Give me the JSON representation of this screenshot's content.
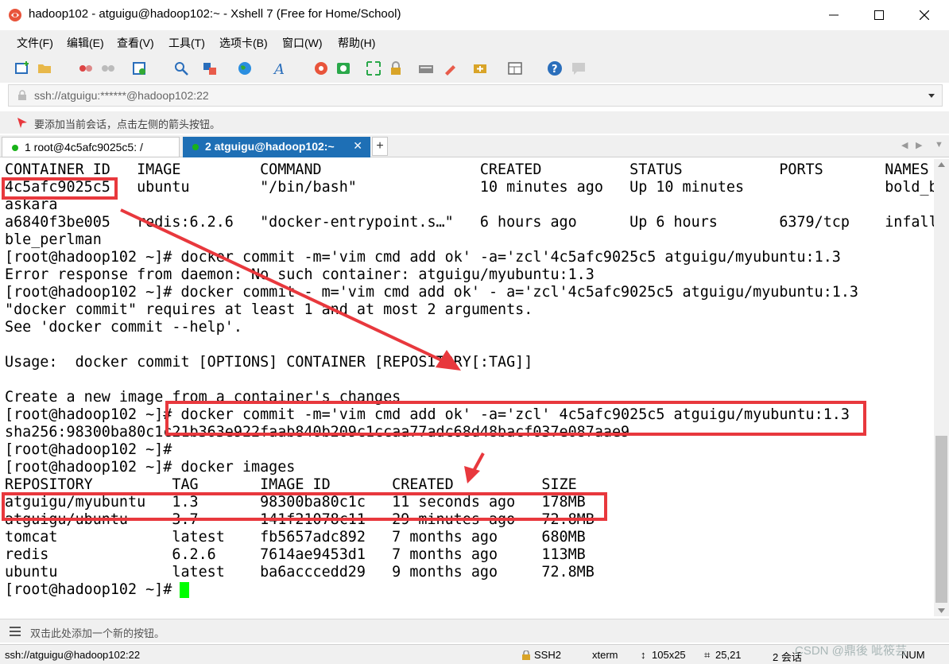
{
  "window": {
    "title": "hadoop102 - atguigu@hadoop102:~ - Xshell 7 (Free for Home/School)"
  },
  "menu": [
    "文件(F)",
    "编辑(E)",
    "查看(V)",
    "工具(T)",
    "选项卡(B)",
    "窗口(W)",
    "帮助(H)"
  ],
  "address": {
    "value": "ssh://atguigu:******@hadoop102:22"
  },
  "hint": "要添加当前会话，点击左侧的箭头按钮。",
  "tabs": [
    {
      "label": "1 root@4c5afc9025c5: /"
    },
    {
      "label": "2 atguigu@hadoop102:~"
    }
  ],
  "terminal": {
    "lines": [
      "CONTAINER ID   IMAGE         COMMAND                  CREATED          STATUS           PORTS       NAMES",
      "4c5afc9025c5   ubuntu        \"/bin/bash\"              10 minutes ago   Up 10 minutes                bold_bh",
      "askara",
      "a6840f3be005   redis:6.2.6   \"docker-entrypoint.s…\"   6 hours ago      Up 6 hours       6379/tcp    infalli",
      "ble_perlman",
      "[root@hadoop102 ~]# docker commit -m='vim cmd add ok' -a='zcl'4c5afc9025c5 atguigu/myubuntu:1.3",
      "Error response from daemon: No such container: atguigu/myubuntu:1.3",
      "[root@hadoop102 ~]# docker commit - m='vim cmd add ok' - a='zcl'4c5afc9025c5 atguigu/myubuntu:1.3",
      "\"docker commit\" requires at least 1 and at most 2 arguments.",
      "See 'docker commit --help'.",
      "",
      "Usage:  docker commit [OPTIONS] CONTAINER [REPOSITORY[:TAG]]",
      "",
      "Create a new image from a container's changes",
      "[root@hadoop102 ~]# docker commit -m='vim cmd add ok' -a='zcl' 4c5afc9025c5 atguigu/myubuntu:1.3",
      "sha256:98300ba80c1c21b363e922faab840b209c1ccaa77adc68d48bacf037e087aae9",
      "[root@hadoop102 ~]#",
      "[root@hadoop102 ~]# docker images",
      "REPOSITORY         TAG       IMAGE ID       CREATED          SIZE",
      "atguigu/myubuntu   1.3       98300ba80c1c   11 seconds ago   178MB",
      "atguigu/ubuntu     3.7       141f21078c11   29 minutes ago   72.8MB",
      "tomcat             latest    fb5657adc892   7 months ago     680MB",
      "redis              6.2.6     7614ae9453d1   7 months ago     113MB",
      "ubuntu             latest    ba6acccedd29   9 months ago     72.8MB",
      "[root@hadoop102 ~]# "
    ]
  },
  "bottom_hint": "双击此处添加一个新的按钮。",
  "status": {
    "connection": "ssh://atguigu@hadoop102:22",
    "protocol": "SSH2",
    "term": "xterm",
    "size": "105x25",
    "position": "25,21",
    "sessions": "2 会话",
    "num": "NUM",
    "watermark": "CSDN @鼎後 呲筱芸"
  }
}
